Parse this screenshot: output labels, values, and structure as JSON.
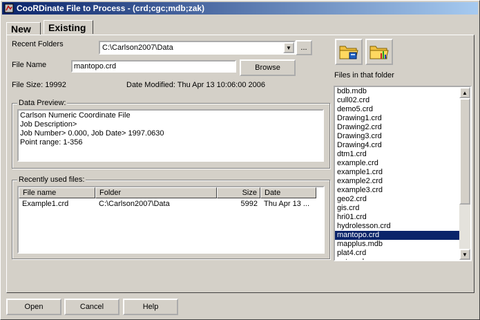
{
  "title": "CooRDinate File to Process - (crd;cgc;mdb;zak)",
  "tabs": [
    {
      "label": "New"
    },
    {
      "label": "Existing"
    }
  ],
  "recent_folders": {
    "label": "Recent Folders",
    "value": "C:\\Carlson2007\\Data",
    "browse_small": "..."
  },
  "file_name": {
    "label": "File Name",
    "value": "mantopo.crd",
    "browse": "Browse"
  },
  "file_info": {
    "size": "File Size: 19992",
    "modified": "Date Modified: Thu Apr 13 10:06:00 2006"
  },
  "preview": {
    "title": "Data Preview:",
    "lines": [
      "Carlson Numeric Coordinate File",
      "Job Description>",
      "Job Number> 0.000, Job Date> 1997.0630",
      "Point range: 1-356"
    ]
  },
  "recent": {
    "title": "Recently used files:",
    "headers": [
      "File name",
      "Folder",
      "Size",
      "Date"
    ],
    "rows": [
      {
        "name": "Example1.crd",
        "folder": "C:\\Carlson2007\\Data",
        "size": "5992",
        "date": "Thu Apr 13 ..."
      }
    ]
  },
  "files_panel": {
    "label": "Files in that folder",
    "files": [
      "bdb.mdb",
      "cull02.crd",
      "demo5.crd",
      "Drawing1.crd",
      "Drawing2.crd",
      "Drawing3.crd",
      "Drawing4.crd",
      "dtm1.crd",
      "example.crd",
      "example1.crd",
      "example2.crd",
      "example3.crd",
      "geo2.crd",
      "gis.crd",
      "hri01.crd",
      "hydrolesson.crd",
      "mantopo.crd",
      "mapplus.mdb",
      "plat4.crd",
      "pnts.crd"
    ],
    "selected": "mantopo.crd"
  },
  "buttons": {
    "open": "Open",
    "cancel": "Cancel",
    "help": "Help"
  },
  "colors": {
    "title_start": "#0a246a",
    "selection": "#0a246a",
    "face": "#d4d0c8"
  }
}
